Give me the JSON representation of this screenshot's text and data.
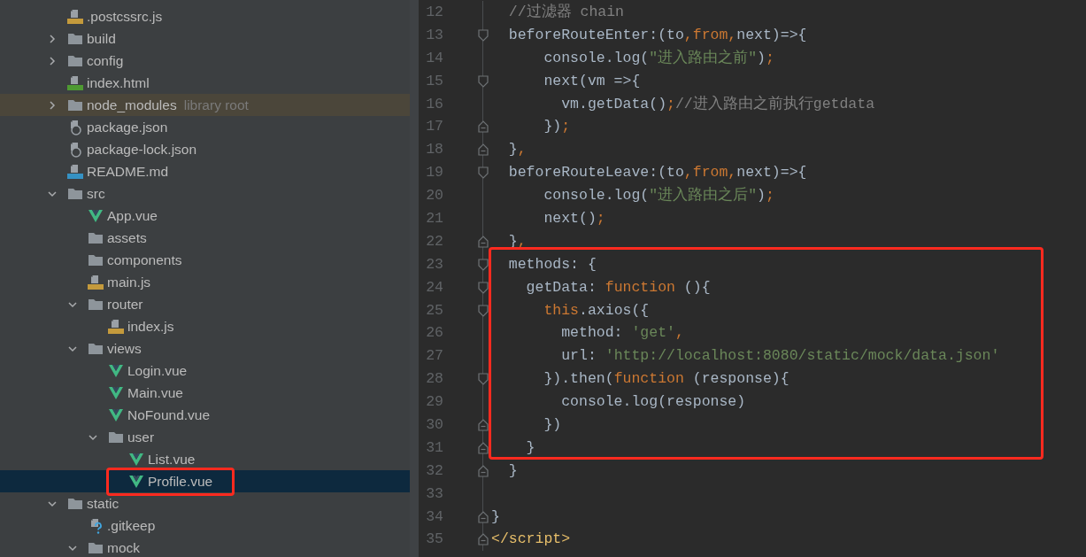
{
  "tree": {
    "items": [
      {
        "name": ".postcssrc.js",
        "kind": "js",
        "selected": false,
        "highlighted": false
      },
      {
        "name": "build",
        "kind": "folder",
        "expanded": false,
        "selected": false,
        "highlighted": false
      },
      {
        "name": "config",
        "kind": "folder",
        "expanded": false,
        "selected": false,
        "highlighted": false
      },
      {
        "name": "index.html",
        "kind": "html",
        "selected": false,
        "highlighted": false
      },
      {
        "name": "node_modules",
        "note": "library root",
        "kind": "folder",
        "expanded": false,
        "selected": false,
        "highlighted": true
      },
      {
        "name": "package.json",
        "kind": "json",
        "selected": false,
        "highlighted": false
      },
      {
        "name": "package-lock.json",
        "kind": "json",
        "selected": false,
        "highlighted": false
      },
      {
        "name": "README.md",
        "kind": "md",
        "selected": false,
        "highlighted": false
      },
      {
        "name": "src",
        "kind": "folder",
        "expanded": true,
        "selected": false,
        "highlighted": false,
        "children": [
          {
            "name": "App.vue",
            "kind": "vue",
            "selected": false,
            "highlighted": false
          },
          {
            "name": "assets",
            "kind": "folder",
            "selected": false,
            "highlighted": false
          },
          {
            "name": "components",
            "kind": "folder",
            "selected": false,
            "highlighted": false
          },
          {
            "name": "main.js",
            "kind": "js",
            "selected": false,
            "highlighted": false
          },
          {
            "name": "router",
            "kind": "folder",
            "expanded": true,
            "selected": false,
            "highlighted": false,
            "children": [
              {
                "name": "index.js",
                "kind": "js",
                "selected": false,
                "highlighted": false
              }
            ]
          },
          {
            "name": "views",
            "kind": "folder",
            "expanded": true,
            "selected": false,
            "highlighted": false,
            "children": [
              {
                "name": "Login.vue",
                "kind": "vue",
                "selected": false,
                "highlighted": false
              },
              {
                "name": "Main.vue",
                "kind": "vue",
                "selected": false,
                "highlighted": false
              },
              {
                "name": "NoFound.vue",
                "kind": "vue",
                "selected": false,
                "highlighted": false
              },
              {
                "name": "user",
                "kind": "folder",
                "expanded": true,
                "selected": false,
                "highlighted": false,
                "children": [
                  {
                    "name": "List.vue",
                    "kind": "vue",
                    "selected": false,
                    "highlighted": false
                  },
                  {
                    "name": "Profile.vue",
                    "kind": "vue",
                    "selected": true,
                    "highlighted": false,
                    "framed": true
                  }
                ]
              }
            ]
          }
        ]
      },
      {
        "name": "static",
        "kind": "folder",
        "expanded": true,
        "selected": false,
        "highlighted": false,
        "children": [
          {
            "name": ".gitkeep",
            "kind": "unknown",
            "selected": false,
            "highlighted": false
          },
          {
            "name": "mock",
            "kind": "folder",
            "expanded": true,
            "selected": false,
            "highlighted": false
          }
        ]
      }
    ]
  },
  "editor": {
    "blocks": [
      {
        "framed": false,
        "lines": [
          {
            "number": "12",
            "kind": "plain",
            "tokens": [
              {
                "text": "  //过滤器 chain",
                "kind": "comment"
              }
            ]
          },
          {
            "number": "13",
            "kind": "fold_start",
            "tokens": [
              {
                "text": "  beforeRouteEnter:(to",
                "kind": "plain"
              },
              {
                "text": ",",
                "kind": "punct"
              },
              {
                "text": "from",
                "kind": "keyword"
              },
              {
                "text": ",",
                "kind": "punct"
              },
              {
                "text": "next)=>{",
                "kind": "plain"
              }
            ]
          },
          {
            "number": "14",
            "kind": "plain",
            "tokens": [
              {
                "text": "      console.log(",
                "kind": "plain"
              },
              {
                "text": "\"进入路由之前\"",
                "kind": "string"
              },
              {
                "text": ")",
                "kind": "plain"
              },
              {
                "text": ";",
                "kind": "punct"
              }
            ]
          },
          {
            "number": "15",
            "kind": "fold_start",
            "tokens": [
              {
                "text": "      next(vm =>{",
                "kind": "plain"
              }
            ]
          },
          {
            "number": "16",
            "kind": "plain",
            "tokens": [
              {
                "text": "        vm.getData()",
                "kind": "plain"
              },
              {
                "text": ";",
                "kind": "punct"
              },
              {
                "text": "//进入路由之前执行getdata",
                "kind": "comment"
              }
            ]
          },
          {
            "number": "17",
            "kind": "fold_end",
            "tokens": [
              {
                "text": "      })",
                "kind": "plain"
              },
              {
                "text": ";",
                "kind": "punct"
              }
            ]
          },
          {
            "number": "18",
            "kind": "fold_end",
            "tokens": [
              {
                "text": "  }",
                "kind": "plain"
              },
              {
                "text": ",",
                "kind": "punct"
              }
            ]
          },
          {
            "number": "19",
            "kind": "fold_start",
            "tokens": [
              {
                "text": "  beforeRouteLeave:(to",
                "kind": "plain"
              },
              {
                "text": ",",
                "kind": "punct"
              },
              {
                "text": "from",
                "kind": "keyword"
              },
              {
                "text": ",",
                "kind": "punct"
              },
              {
                "text": "next)=>{",
                "kind": "plain"
              }
            ]
          },
          {
            "number": "20",
            "kind": "plain",
            "tokens": [
              {
                "text": "      console.log(",
                "kind": "plain"
              },
              {
                "text": "\"进入路由之后\"",
                "kind": "string"
              },
              {
                "text": ")",
                "kind": "plain"
              },
              {
                "text": ";",
                "kind": "punct"
              }
            ]
          },
          {
            "number": "21",
            "kind": "plain",
            "tokens": [
              {
                "text": "      next()",
                "kind": "plain"
              },
              {
                "text": ";",
                "kind": "punct"
              }
            ]
          },
          {
            "number": "22",
            "kind": "fold_end",
            "tokens": [
              {
                "text": "  }",
                "kind": "plain"
              },
              {
                "text": ",",
                "kind": "punct"
              }
            ]
          }
        ]
      },
      {
        "framed": true,
        "lines": [
          {
            "number": "23",
            "kind": "fold_start",
            "tokens": [
              {
                "text": "  methods: {",
                "kind": "plain"
              }
            ]
          },
          {
            "number": "24",
            "kind": "fold_start",
            "tokens": [
              {
                "text": "    getData: ",
                "kind": "plain"
              },
              {
                "text": "function",
                "kind": "keyword"
              },
              {
                "text": " (){",
                "kind": "plain"
              }
            ]
          },
          {
            "number": "25",
            "kind": "fold_start",
            "tokens": [
              {
                "text": "      this",
                "kind": "keyword"
              },
              {
                "text": ".axios({",
                "kind": "plain"
              }
            ]
          },
          {
            "number": "26",
            "kind": "plain",
            "tokens": [
              {
                "text": "        method: ",
                "kind": "plain"
              },
              {
                "text": "'get'",
                "kind": "string"
              },
              {
                "text": ",",
                "kind": "punct"
              }
            ]
          },
          {
            "number": "27",
            "kind": "plain",
            "tokens": [
              {
                "text": "        url: ",
                "kind": "plain"
              },
              {
                "text": "'http://localhost:8080/static/mock/data.json'",
                "kind": "string"
              }
            ]
          },
          {
            "number": "28",
            "kind": "fold_start",
            "tokens": [
              {
                "text": "      }).then(",
                "kind": "plain"
              },
              {
                "text": "function",
                "kind": "keyword"
              },
              {
                "text": " (response){",
                "kind": "plain"
              }
            ]
          },
          {
            "number": "29",
            "kind": "plain",
            "tokens": [
              {
                "text": "        console.log(response)",
                "kind": "plain"
              }
            ]
          },
          {
            "number": "30",
            "kind": "fold_end",
            "tokens": [
              {
                "text": "      })",
                "kind": "plain"
              }
            ]
          },
          {
            "number": "31",
            "kind": "fold_end",
            "tokens": [
              {
                "text": "    }",
                "kind": "plain"
              }
            ]
          }
        ]
      },
      {
        "framed": false,
        "lines": [
          {
            "number": "32",
            "kind": "fold_end",
            "tokens": [
              {
                "text": "  }",
                "kind": "plain"
              }
            ]
          },
          {
            "number": "33",
            "kind": "plain"
          },
          {
            "number": "34",
            "kind": "fold_end",
            "tokens": [
              {
                "text": "}",
                "kind": "plain"
              }
            ]
          },
          {
            "number": "35",
            "kind": "fold_end",
            "tokens": [
              {
                "text": "</script>",
                "kind": "tag"
              }
            ]
          }
        ]
      }
    ]
  }
}
